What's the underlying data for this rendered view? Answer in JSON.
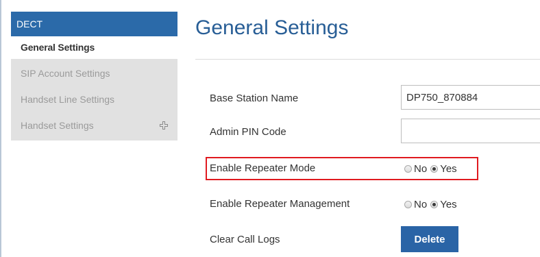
{
  "sidebar": {
    "header": "DECT",
    "active_item": "General Settings",
    "items": [
      {
        "label": "SIP Account Settings",
        "icon": ""
      },
      {
        "label": "Handset Line Settings",
        "icon": ""
      },
      {
        "label": "Handset Settings",
        "icon": "expand-plus-icon"
      }
    ]
  },
  "main": {
    "title": "General Settings",
    "fields": {
      "base_station_name": {
        "label": "Base Station Name",
        "value": "DP750_870884"
      },
      "admin_pin_code": {
        "label": "Admin PIN Code",
        "value": ""
      },
      "repeater_mode": {
        "label": "Enable Repeater Mode",
        "no": "No",
        "yes": "Yes",
        "selected": "Yes"
      },
      "repeater_management": {
        "label": "Enable Repeater Management",
        "no": "No",
        "yes": "Yes",
        "selected": "Yes"
      },
      "clear_call_logs": {
        "label": "Clear Call Logs",
        "button": "Delete"
      }
    }
  },
  "colors": {
    "sidebar_header": "#2b6aa9",
    "title": "#285e96",
    "highlight": "#e0191f",
    "button": "#2a64a6"
  }
}
